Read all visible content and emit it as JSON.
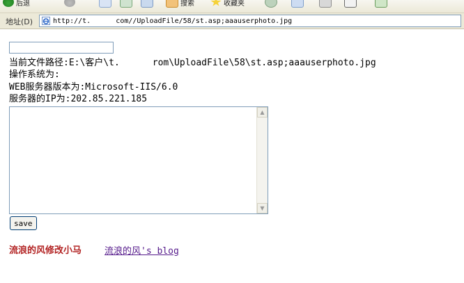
{
  "toolbar": {
    "items": [
      {
        "icon": "back-arrow-icon",
        "label": "后退"
      },
      {
        "icon": "forward-arrow-icon",
        "label": ""
      },
      {
        "icon": "stop-icon",
        "label": ""
      },
      {
        "icon": "refresh-icon",
        "label": ""
      },
      {
        "icon": "home-icon",
        "label": ""
      },
      {
        "icon": "search-icon",
        "label": "搜索"
      },
      {
        "icon": "favorites-star-icon",
        "label": "收藏夹"
      },
      {
        "icon": "history-icon",
        "label": ""
      },
      {
        "icon": "mail-icon",
        "label": ""
      },
      {
        "icon": "print-icon",
        "label": ""
      },
      {
        "icon": "edit-icon",
        "label": ""
      },
      {
        "icon": "discuss-icon",
        "label": ""
      }
    ]
  },
  "address_bar": {
    "label": "地址(D)",
    "url": "http://t.      com//UploadFile/58/st.asp;aaauserphoto.jpg"
  },
  "page": {
    "input_value": "",
    "path_line": "当前文件路径:E:\\客户\\t.      rom\\UploadFile\\58\\st.asp;aaauserphoto.jpg",
    "os_line": "操作系统为:",
    "web_server_line": "WEB服务器版本为:Microsoft-IIS/6.0",
    "ip_line": "服务器的IP为:202.85.221.185",
    "textarea_value": "",
    "save_label": "save",
    "signature": "流浪的风修改小马",
    "blog_link": "流浪的风's blog"
  },
  "colors": {
    "signature": "#b22222",
    "link_visited": "#551a8b",
    "input_border": "#7f9db9"
  }
}
